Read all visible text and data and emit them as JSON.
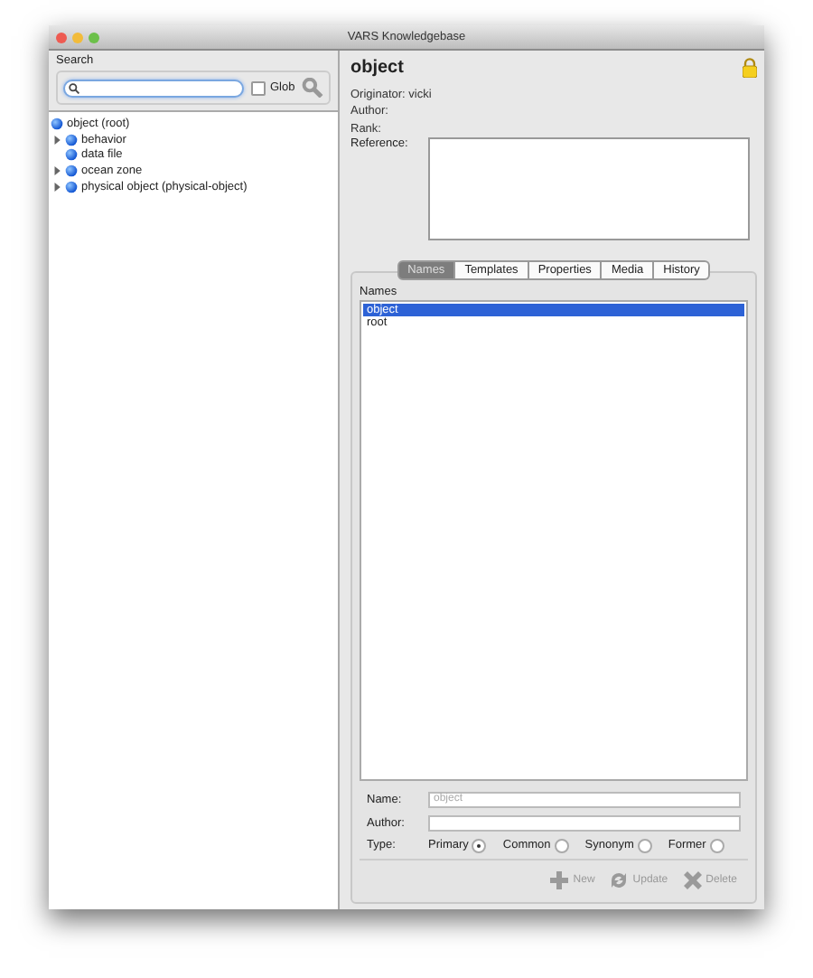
{
  "window": {
    "title": "VARS Knowledgebase"
  },
  "search": {
    "label": "Search",
    "glob": {
      "label": "Glob",
      "checked": false
    }
  },
  "tree": [
    {
      "label": "object (root)",
      "kind": "root",
      "children": [
        {
          "label": "behavior",
          "kind": "branch",
          "expanded": false
        },
        {
          "label": "data file",
          "kind": "leaf"
        },
        {
          "label": "ocean zone",
          "kind": "branch",
          "expanded": false
        },
        {
          "label": "physical object (physical-object)",
          "kind": "branch",
          "expanded": false
        }
      ]
    }
  ],
  "detail": {
    "title": "object",
    "locked": true,
    "fields": [
      {
        "label": "Originator:",
        "value": "vicki"
      },
      {
        "label": "Author:"
      },
      {
        "label": "Rank:"
      }
    ],
    "reference_label": "Reference:"
  },
  "tabs": [
    {
      "label": "Names",
      "selected": true
    },
    {
      "label": "Templates",
      "selected": false
    },
    {
      "label": "Properties",
      "selected": false
    },
    {
      "label": "Media",
      "selected": false
    },
    {
      "label": "History",
      "selected": false
    }
  ],
  "names": {
    "label": "Names",
    "items": [
      {
        "label": "object",
        "selected": true
      },
      {
        "label": "root",
        "selected": false
      }
    ]
  },
  "form": {
    "name": {
      "label": "Name:",
      "value": "object",
      "disabled": true
    },
    "author": {
      "label": "Author:"
    },
    "type_label": "Type:",
    "types": [
      {
        "label": "Primary",
        "selected": true
      },
      {
        "label": "Common",
        "selected": false
      },
      {
        "label": "Synonym",
        "selected": false
      },
      {
        "label": "Former",
        "selected": false
      }
    ]
  },
  "buttons": [
    {
      "label": "New",
      "kind": "new",
      "disabled": true
    },
    {
      "label": "Update",
      "kind": "update",
      "disabled": true
    },
    {
      "label": "Delete",
      "kind": "delete",
      "disabled": true
    }
  ]
}
